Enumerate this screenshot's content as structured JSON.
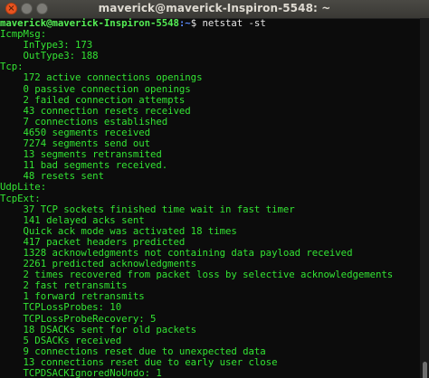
{
  "window": {
    "title": "maverick@maverick-Inspiron-5548: ~",
    "close_glyph": "×",
    "colors": {
      "titlebar": "#3f3e3a",
      "close": "#e95420",
      "background": "#0c0c0c",
      "text": "#33e433"
    }
  },
  "prompt": {
    "user_host": "maverick@maverick-Inspiron-5548",
    "path": ":~",
    "symbol_and_command": "$ netstat -st"
  },
  "output_lines": [
    "IcmpMsg:",
    "    InType3: 173",
    "    OutType3: 188",
    "Tcp:",
    "    172 active connections openings",
    "    0 passive connection openings",
    "    2 failed connection attempts",
    "    43 connection resets received",
    "    7 connections established",
    "    4650 segments received",
    "    7274 segments send out",
    "    13 segments retransmited",
    "    11 bad segments received.",
    "    48 resets sent",
    "UdpLite:",
    "TcpExt:",
    "    37 TCP sockets finished time wait in fast timer",
    "    141 delayed acks sent",
    "    Quick ack mode was activated 18 times",
    "    417 packet headers predicted",
    "    1328 acknowledgments not containing data payload received",
    "    2261 predicted acknowledgments",
    "    2 times recovered from packet loss by selective acknowledgements",
    "    2 fast retransmits",
    "    1 forward retransmits",
    "    TCPLossProbes: 10",
    "    TCPLossProbeRecovery: 5",
    "    18 DSACKs sent for old packets",
    "    5 DSACKs received",
    "    9 connections reset due to unexpected data",
    "    13 connections reset due to early user close",
    "    TCPDSACKIgnoredNoUndo: 1"
  ]
}
